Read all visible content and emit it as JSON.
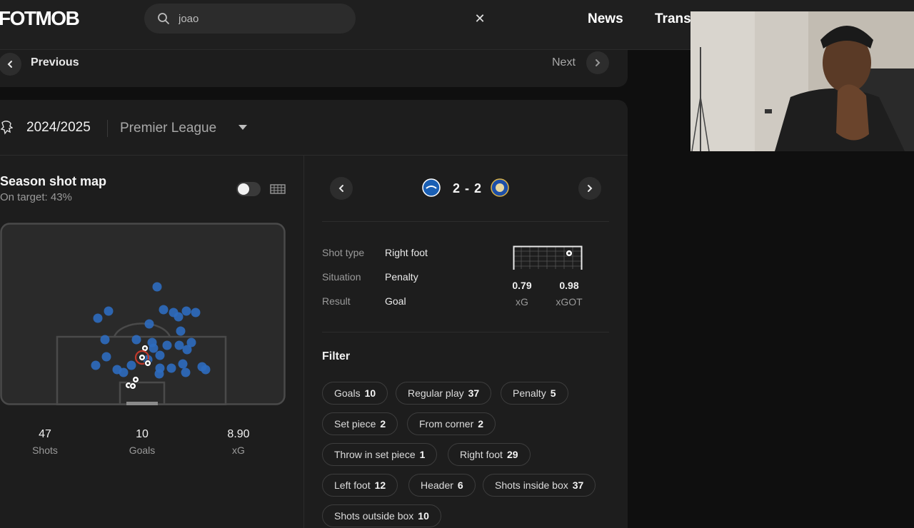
{
  "header": {
    "logo": "FOTMOB",
    "search_value": "joao",
    "nav": [
      "News",
      "Trans"
    ]
  },
  "pager": {
    "prev_label": "Previous",
    "next_label": "Next"
  },
  "league": {
    "season": "2024/2025",
    "name": "Premier League"
  },
  "shotmap": {
    "title": "Season shot map",
    "subtitle": "On target: 43%",
    "stats": [
      {
        "value": "47",
        "label": "Shots"
      },
      {
        "value": "10",
        "label": "Goals"
      },
      {
        "value": "8.90",
        "label": "xG"
      }
    ]
  },
  "match": {
    "score": "2 - 2"
  },
  "details": {
    "shot_type_label": "Shot type",
    "shot_type": "Right foot",
    "situation_label": "Situation",
    "situation": "Penalty",
    "result_label": "Result",
    "result": "Goal",
    "xg_value": "0.79",
    "xg_label": "xG",
    "xgot_value": "0.98",
    "xgot_label": "xGOT"
  },
  "filter": {
    "title": "Filter",
    "chips": [
      {
        "label": "Goals",
        "count": "10"
      },
      {
        "label": "Regular play",
        "count": "37"
      },
      {
        "label": "Penalty",
        "count": "5"
      },
      {
        "label": "Set piece",
        "count": "2"
      },
      {
        "label": "From corner",
        "count": "2"
      },
      {
        "label": "Throw in set piece",
        "count": "1"
      },
      {
        "label": "Right foot",
        "count": "29"
      },
      {
        "label": "Left foot",
        "count": "12"
      },
      {
        "label": "Header",
        "count": "6"
      },
      {
        "label": "Shots inside box",
        "count": "37"
      },
      {
        "label": "Shots outside box",
        "count": "10"
      }
    ]
  },
  "colors": {
    "shot_blue": "#2e6bbf",
    "goal_white": "#ffffff",
    "selected_red": "#c0392b"
  }
}
